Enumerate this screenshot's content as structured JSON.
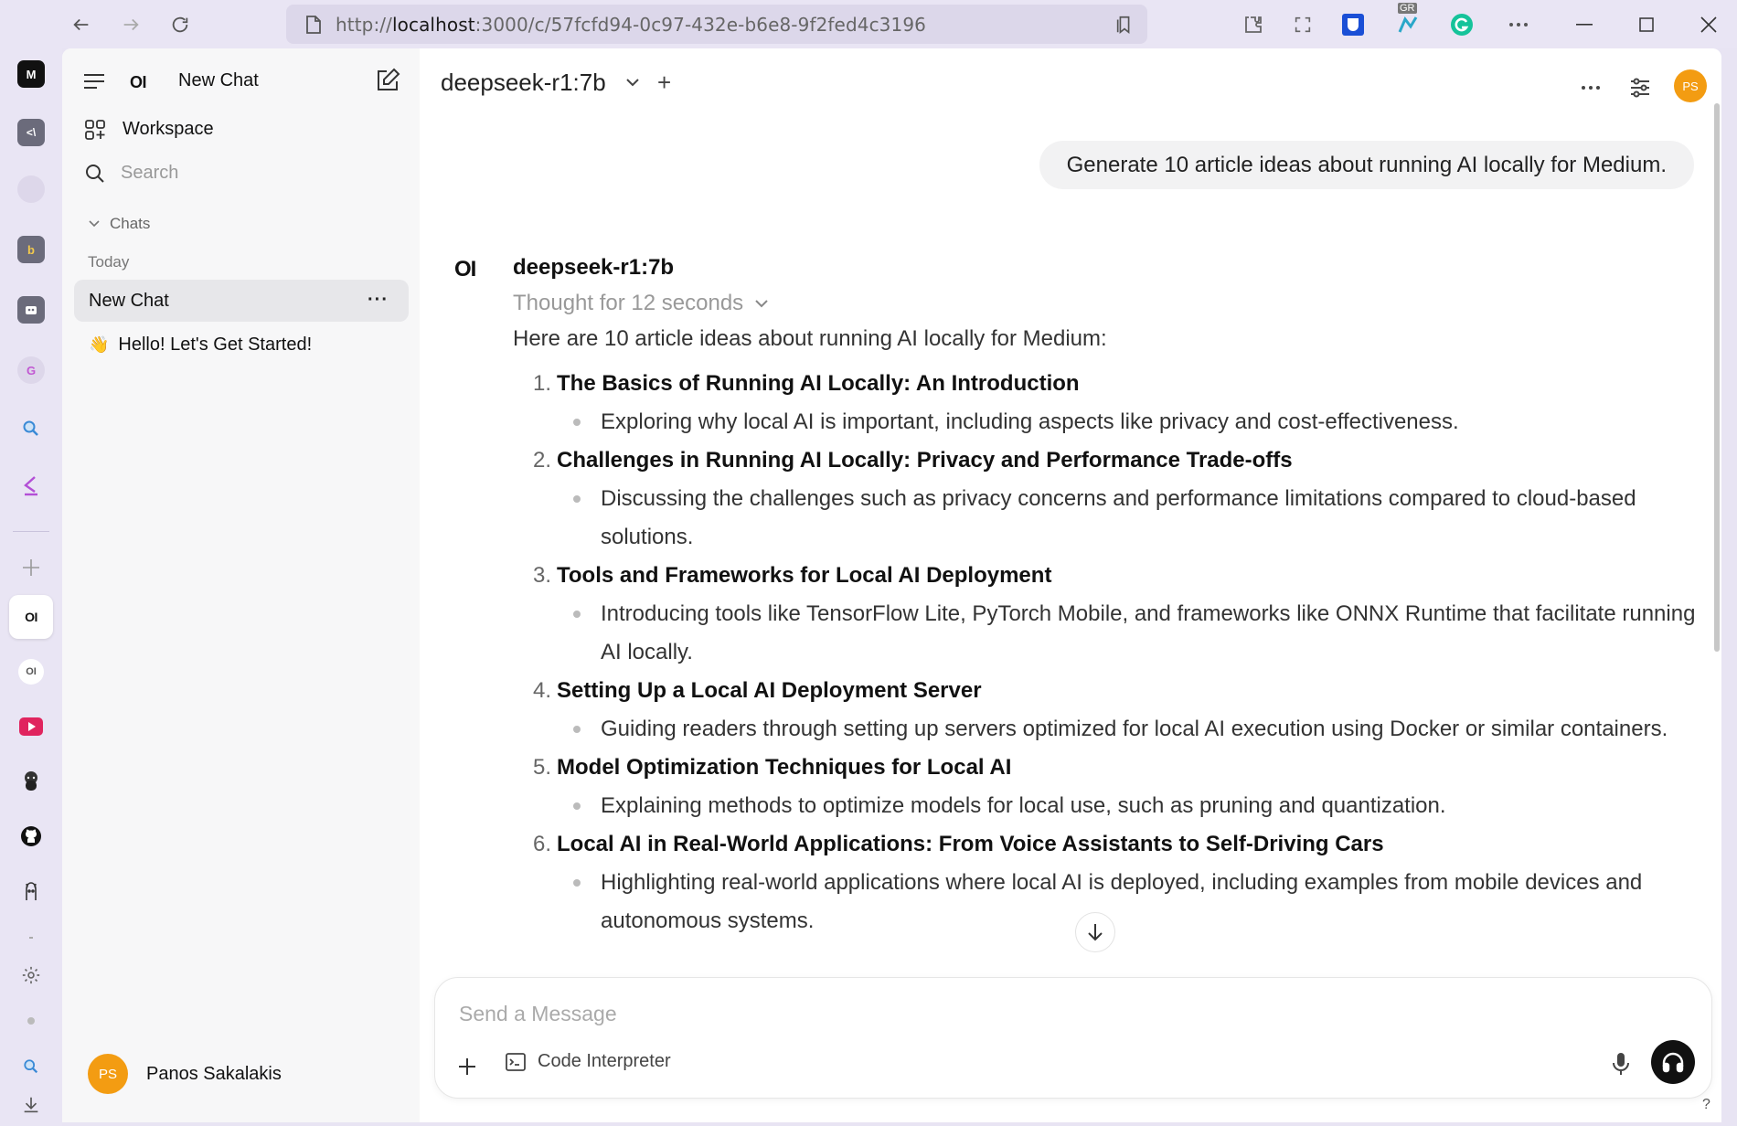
{
  "browser": {
    "url_prefix": "http://",
    "url_host": "localhost",
    "url_rest": ":3000/c/57fcfd94-0c97-432e-b6e8-9f2fed4c3196",
    "extension_badge": "GR"
  },
  "edge_tabs": [
    {
      "label": "M",
      "icon": "medium-icon",
      "color": "#111111"
    },
    {
      "label": "<\\",
      "icon": "terminal-icon",
      "color": "#6b6b7b"
    },
    {
      "label": "",
      "icon": "blank-tab-icon",
      "color": "#d9d4e6"
    },
    {
      "label": "b",
      "icon": "bing-icon",
      "color": "#6b6b7b"
    },
    {
      "label": "",
      "icon": "robot-icon",
      "color": "#6b6b7b"
    },
    {
      "label": "G",
      "icon": "grammar-icon",
      "color": "#c58bd4"
    }
  ],
  "sidebar": {
    "brand": "OI",
    "new_chat_title": "New Chat",
    "workspace_label": "Workspace",
    "search_placeholder": "Search",
    "section_label": "Chats",
    "group_label": "Today",
    "chats": [
      {
        "label": "New Chat"
      },
      {
        "emoji": "👋",
        "label": "Hello! Let's Get Started!"
      }
    ],
    "user": {
      "initials": "PS",
      "name": "Panos Sakalakis"
    }
  },
  "header": {
    "model": "deepseek-r1:7b",
    "add_label": "+",
    "avatar_initials": "PS"
  },
  "conversation": {
    "user_message": "Generate 10 article ideas about running AI locally for Medium.",
    "assistant_logo": "OI",
    "assistant_name": "deepseek-r1:7b",
    "thought": "Thought for 12 seconds",
    "intro": "Here are 10 article ideas about running AI locally for Medium:",
    "ideas": [
      {
        "num": "1.",
        "title": "The Basics of Running AI Locally: An Introduction",
        "desc": "Exploring why local AI is important, including aspects like privacy and cost-effectiveness."
      },
      {
        "num": "2.",
        "title": "Challenges in Running AI Locally: Privacy and Performance Trade-offs",
        "desc": "Discussing the challenges such as privacy concerns and performance limitations compared to cloud-based solutions."
      },
      {
        "num": "3.",
        "title": "Tools and Frameworks for Local AI Deployment",
        "desc": "Introducing tools like TensorFlow Lite, PyTorch Mobile, and frameworks like ONNX Runtime that facilitate running AI locally."
      },
      {
        "num": "4.",
        "title": "Setting Up a Local AI Deployment Server",
        "desc": "Guiding readers through setting up servers optimized for local AI execution using Docker or similar containers."
      },
      {
        "num": "5.",
        "title": "Model Optimization Techniques for Local AI",
        "desc": "Explaining methods to optimize models for local use, such as pruning and quantization."
      },
      {
        "num": "6.",
        "title": "Local AI in Real-World Applications: From Voice Assistants to Self-Driving Cars",
        "desc": "Highlighting real-world applications where local AI is deployed, including examples from mobile devices and autonomous systems."
      }
    ]
  },
  "composer": {
    "placeholder": "Send a Message",
    "code_interpreter_label": "Code Interpreter"
  },
  "help_label": "?"
}
